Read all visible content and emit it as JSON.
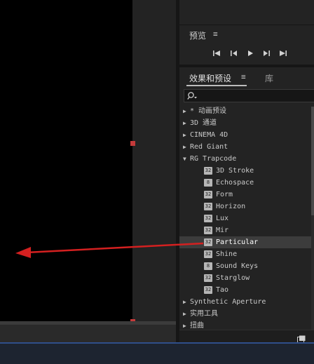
{
  "preview_panel": {
    "title": "预览",
    "menu_icon": "≡",
    "controls": [
      {
        "name": "first-frame-icon"
      },
      {
        "name": "prev-frame-icon"
      },
      {
        "name": "play-icon"
      },
      {
        "name": "next-frame-icon"
      },
      {
        "name": "last-frame-icon"
      }
    ]
  },
  "effects_panel": {
    "tab_label": "效果和预设",
    "menu_icon": "≡",
    "library_tab": "库",
    "search": {
      "placeholder": "",
      "icon": "search-icon"
    },
    "tree": [
      {
        "label": "* 动画预设",
        "type": "category",
        "expanded": false
      },
      {
        "label": "3D 通道",
        "type": "category",
        "expanded": false
      },
      {
        "label": "CINEMA 4D",
        "type": "category",
        "expanded": false
      },
      {
        "label": "Red Giant",
        "type": "category",
        "expanded": false
      },
      {
        "label": "RG Trapcode",
        "type": "category",
        "expanded": true
      },
      {
        "label": "3D Stroke",
        "type": "effect",
        "badge": "32"
      },
      {
        "label": "Echospace",
        "type": "effect",
        "badge": "8"
      },
      {
        "label": "Form",
        "type": "effect",
        "badge": "32"
      },
      {
        "label": "Horizon",
        "type": "effect",
        "badge": "32"
      },
      {
        "label": "Lux",
        "type": "effect",
        "badge": "32"
      },
      {
        "label": "Mir",
        "type": "effect",
        "badge": "32"
      },
      {
        "label": "Particular",
        "type": "effect",
        "badge": "32",
        "selected": true
      },
      {
        "label": "Shine",
        "type": "effect",
        "badge": "32"
      },
      {
        "label": "Sound Keys",
        "type": "effect",
        "badge": "8"
      },
      {
        "label": "Starglow",
        "type": "effect",
        "badge": "32"
      },
      {
        "label": "Tao",
        "type": "effect",
        "badge": "32"
      },
      {
        "label": "Synthetic Aperture",
        "type": "category",
        "expanded": false
      },
      {
        "label": "实用工具",
        "type": "category",
        "expanded": false
      },
      {
        "label": "扭曲",
        "type": "category",
        "expanded": false
      }
    ]
  },
  "colors": {
    "annotation_arrow": "#d42020",
    "selection": "#3c3c3c",
    "accent_strip": "#2f4f8a"
  }
}
